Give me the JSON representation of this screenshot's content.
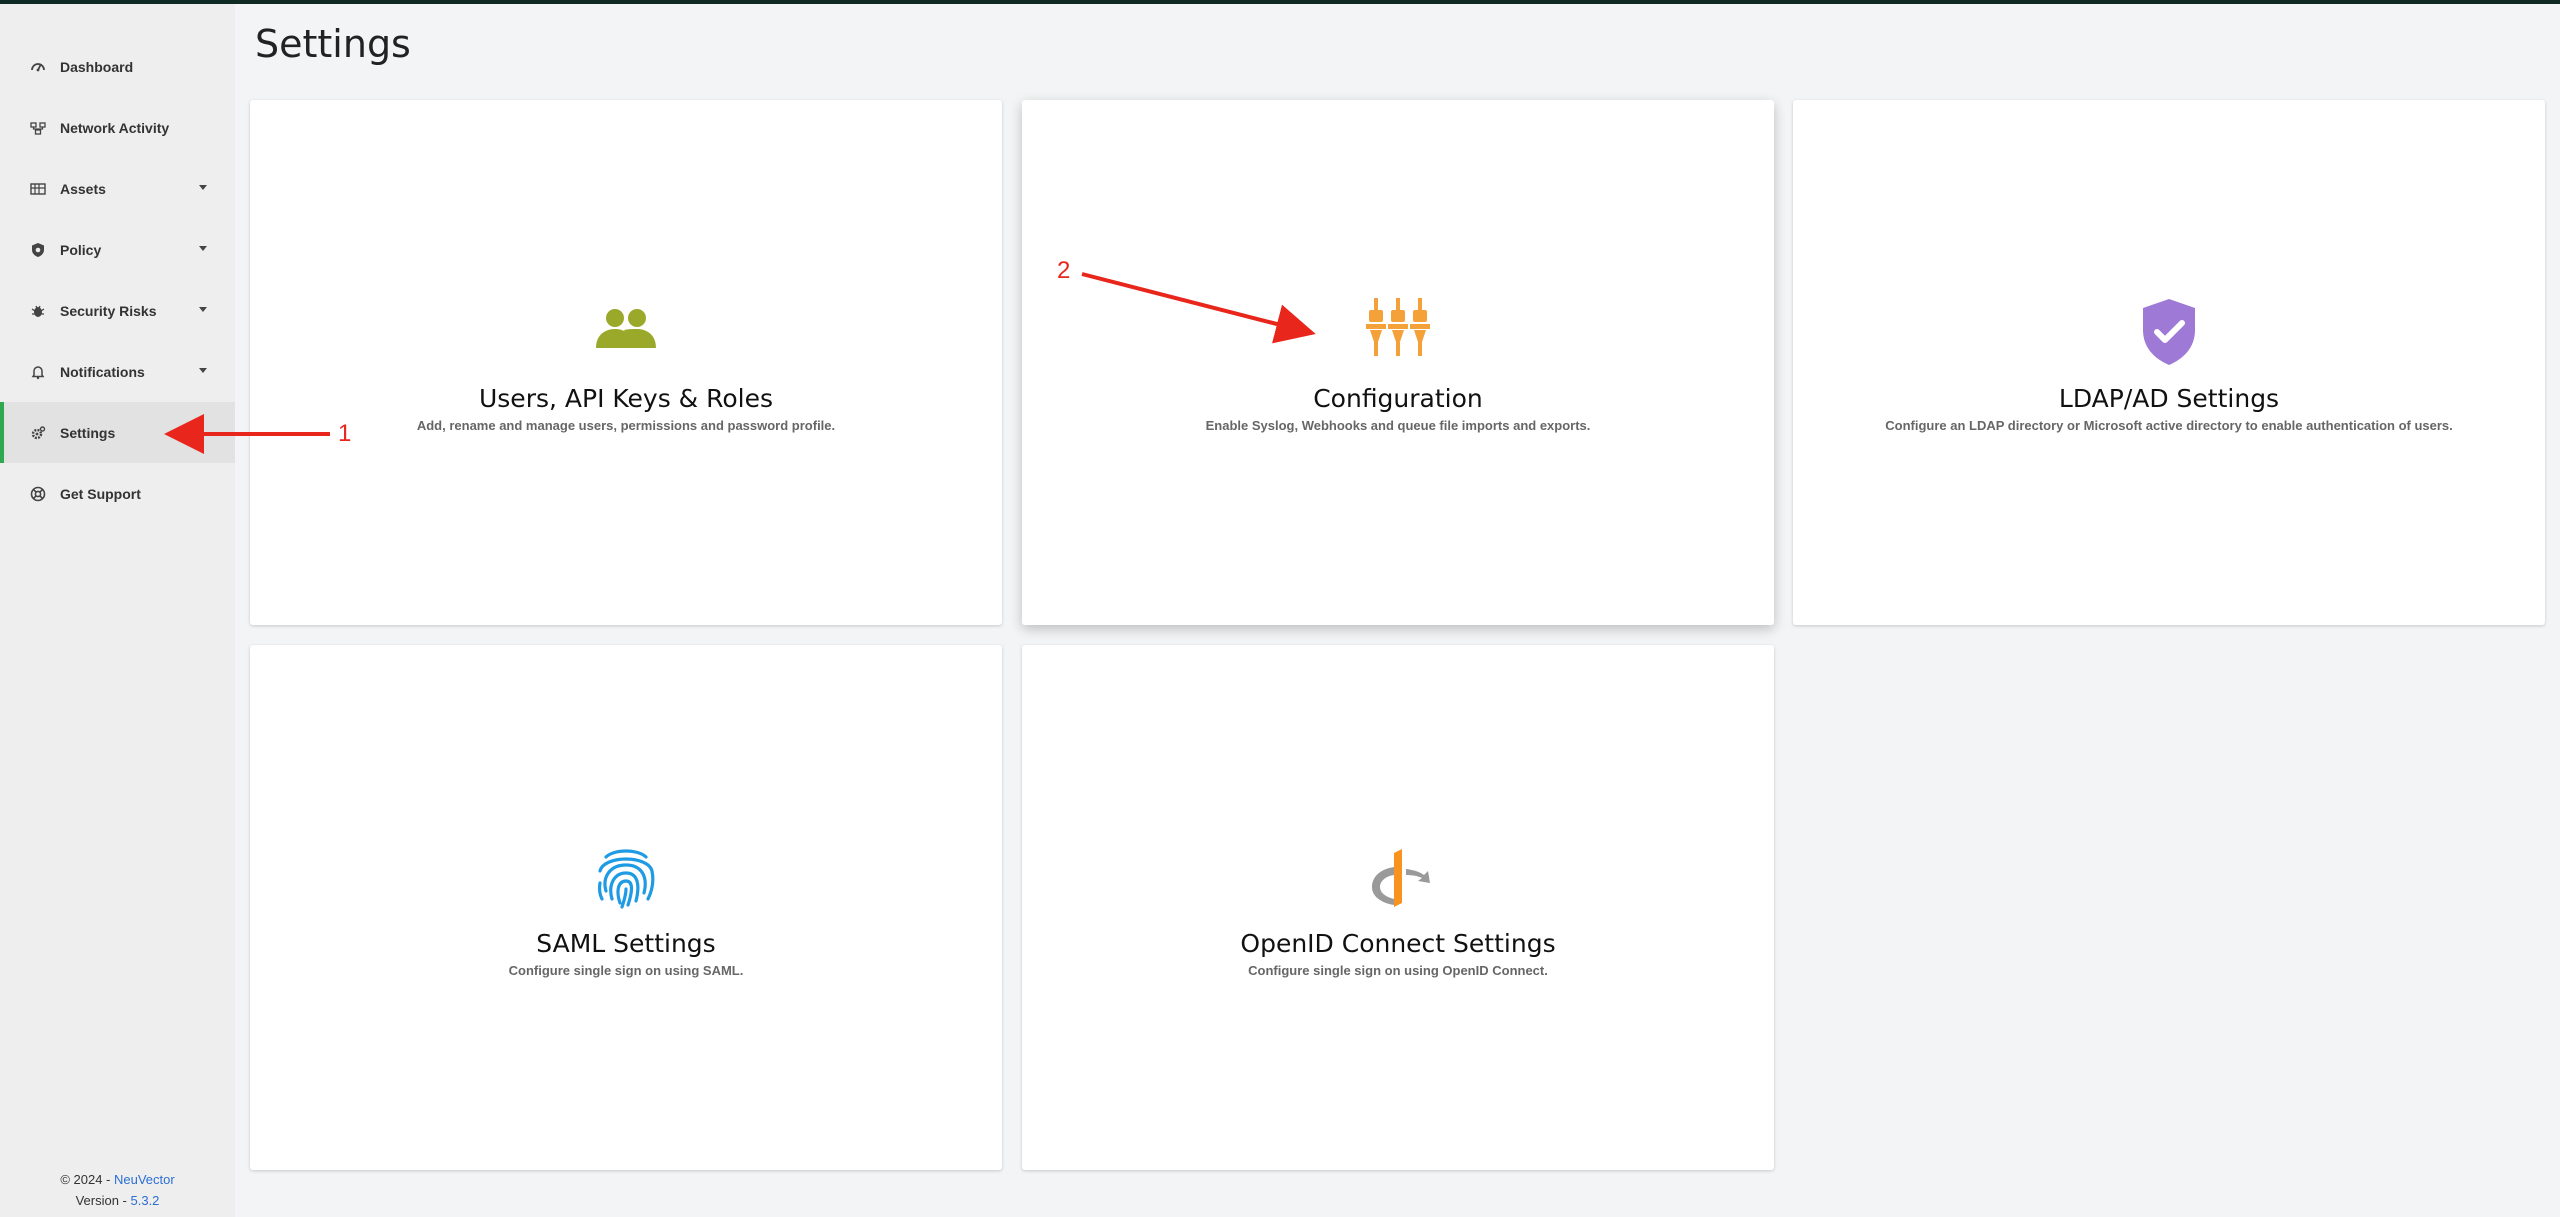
{
  "sidebar": {
    "items": [
      {
        "label": "Dashboard",
        "icon": "dashboard-icon",
        "has_caret": false
      },
      {
        "label": "Network Activity",
        "icon": "network-icon",
        "has_caret": false
      },
      {
        "label": "Assets",
        "icon": "assets-icon",
        "has_caret": true
      },
      {
        "label": "Policy",
        "icon": "policy-shield-icon",
        "has_caret": true
      },
      {
        "label": "Security Risks",
        "icon": "bug-icon",
        "has_caret": true
      },
      {
        "label": "Notifications",
        "icon": "bell-icon",
        "has_caret": true
      },
      {
        "label": "Settings",
        "icon": "gear-icon",
        "has_caret": false,
        "active": true
      },
      {
        "label": "Get Support",
        "icon": "lifebuoy-icon",
        "has_caret": false
      }
    ],
    "footer": {
      "copyright": "© 2024 - ",
      "brand": "NeuVector",
      "version_label": "Version - ",
      "version": "5.3.2"
    }
  },
  "page": {
    "title": "Settings"
  },
  "cards": [
    {
      "title": "Users, API Keys & Roles",
      "description": "Add, rename and manage users, permissions and password profile.",
      "icon": "users-icon",
      "icon_color": "#9aa92a"
    },
    {
      "title": "Configuration",
      "description": "Enable Syslog, Webhooks and queue file imports and exports.",
      "icon": "plugs-icon",
      "icon_color": "#f5a13a"
    },
    {
      "title": "LDAP/AD Settings",
      "description": "Configure an LDAP directory or Microsoft active directory to enable authentication of users.",
      "icon": "shield-check-icon",
      "icon_color": "#9e79d6"
    },
    {
      "title": "SAML Settings",
      "description": "Configure single sign on using SAML.",
      "icon": "fingerprint-icon",
      "icon_color": "#1e9be4"
    },
    {
      "title": "OpenID Connect Settings",
      "description": "Configure single sign on using OpenID Connect.",
      "icon": "openid-icon",
      "icon_color": "#f7931e"
    }
  ],
  "annotations": {
    "step1": "1",
    "step2": "2",
    "color": "#e8261b"
  }
}
